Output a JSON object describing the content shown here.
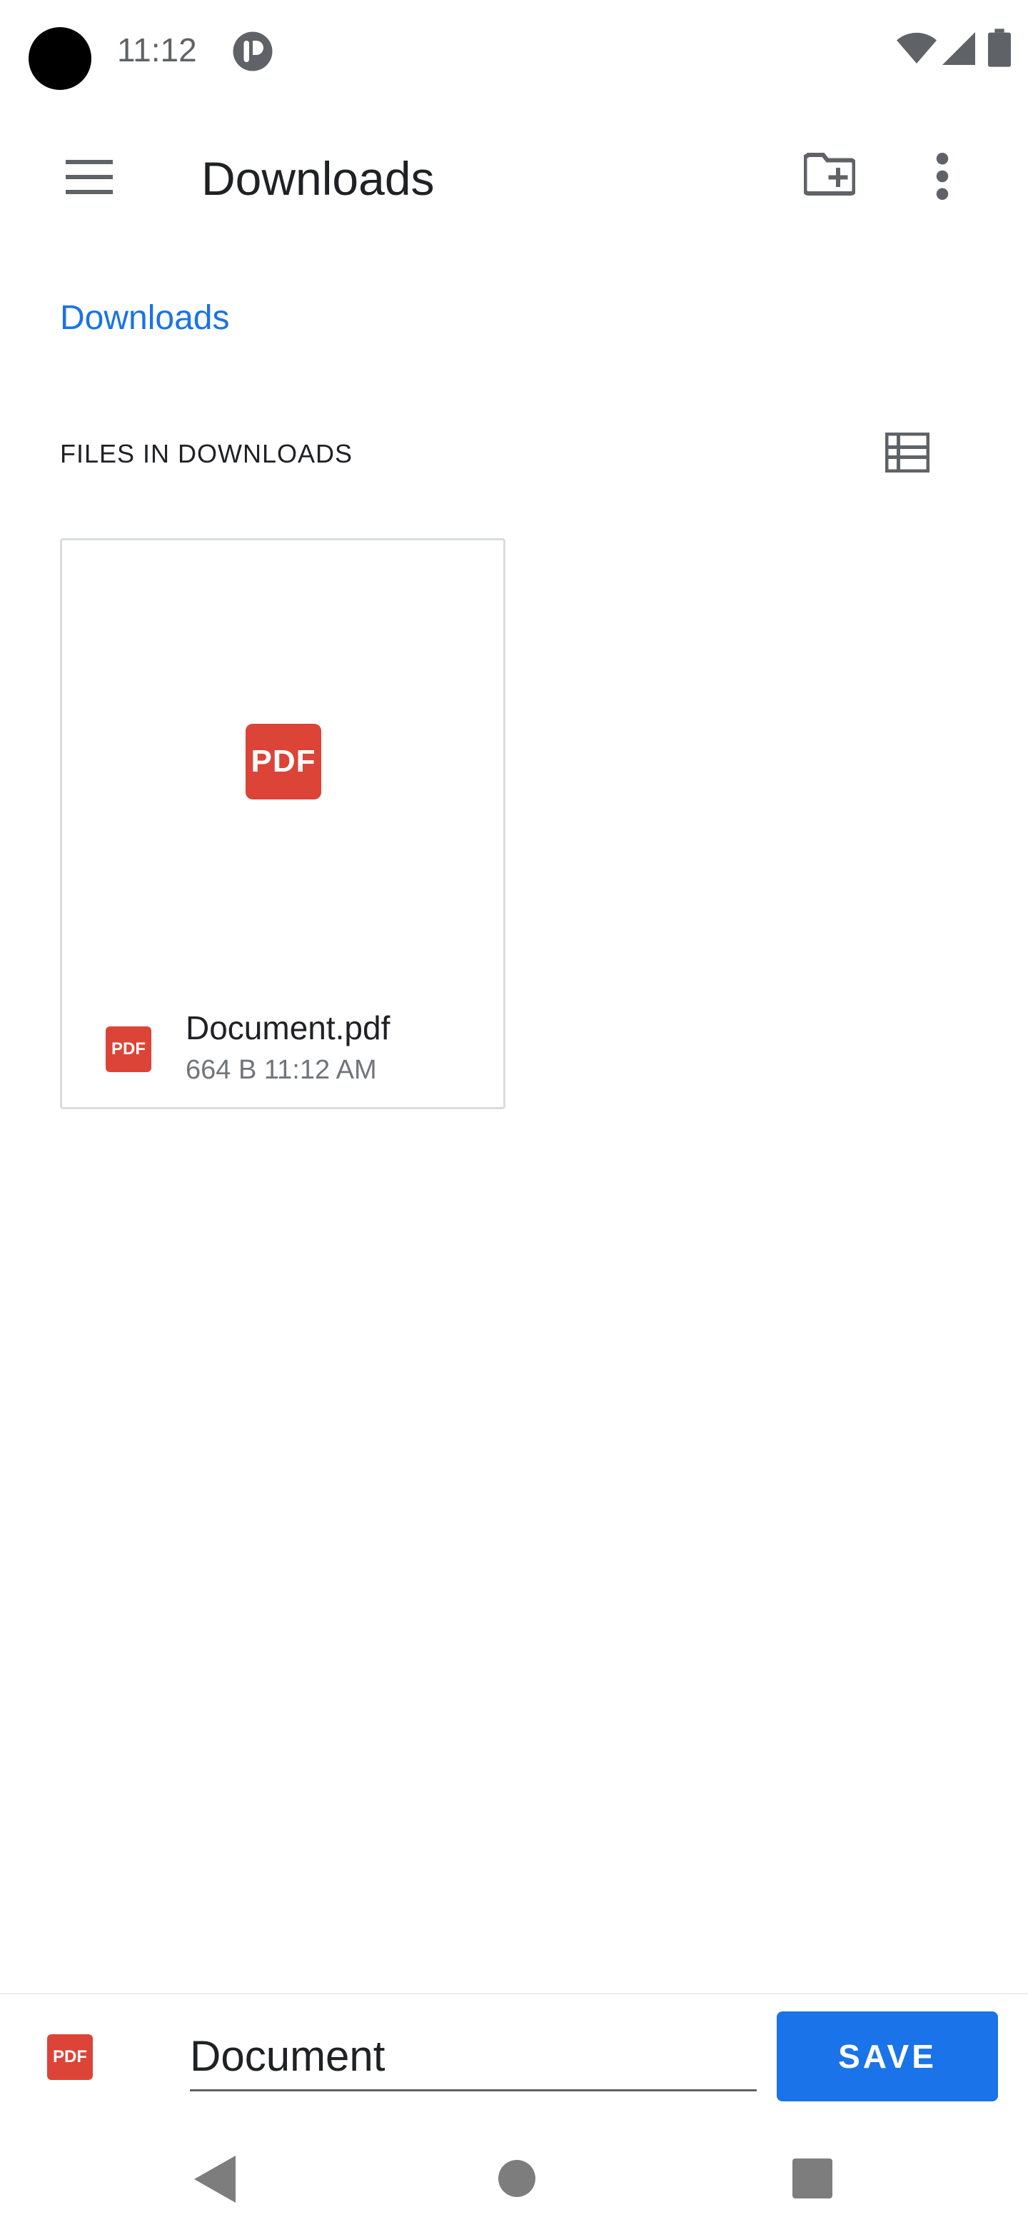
{
  "status_bar": {
    "time": "11:12",
    "icons": [
      "camera-dot",
      "app-notification-icon",
      "wifi-icon",
      "signal-icon",
      "battery-icon"
    ]
  },
  "toolbar": {
    "title": "Downloads",
    "icons": [
      "hamburger-menu-icon",
      "new-folder-icon",
      "more-vert-icon"
    ]
  },
  "breadcrumb": {
    "label": "Downloads",
    "color": "#1a73e8"
  },
  "section": {
    "header": "FILES IN DOWNLOADS"
  },
  "files": [
    {
      "thumb_label": "PDF",
      "type_badge": "PDF",
      "name": "Document.pdf",
      "meta": "664 B 11:12 AM"
    }
  ],
  "save_bar": {
    "type_badge": "PDF",
    "filename_value": "Document",
    "save_label": "SAVE",
    "accent": "#1a73e8"
  },
  "colors": {
    "pdf_red": "#db4437",
    "text_primary": "#202124",
    "text_secondary": "#70757a"
  }
}
